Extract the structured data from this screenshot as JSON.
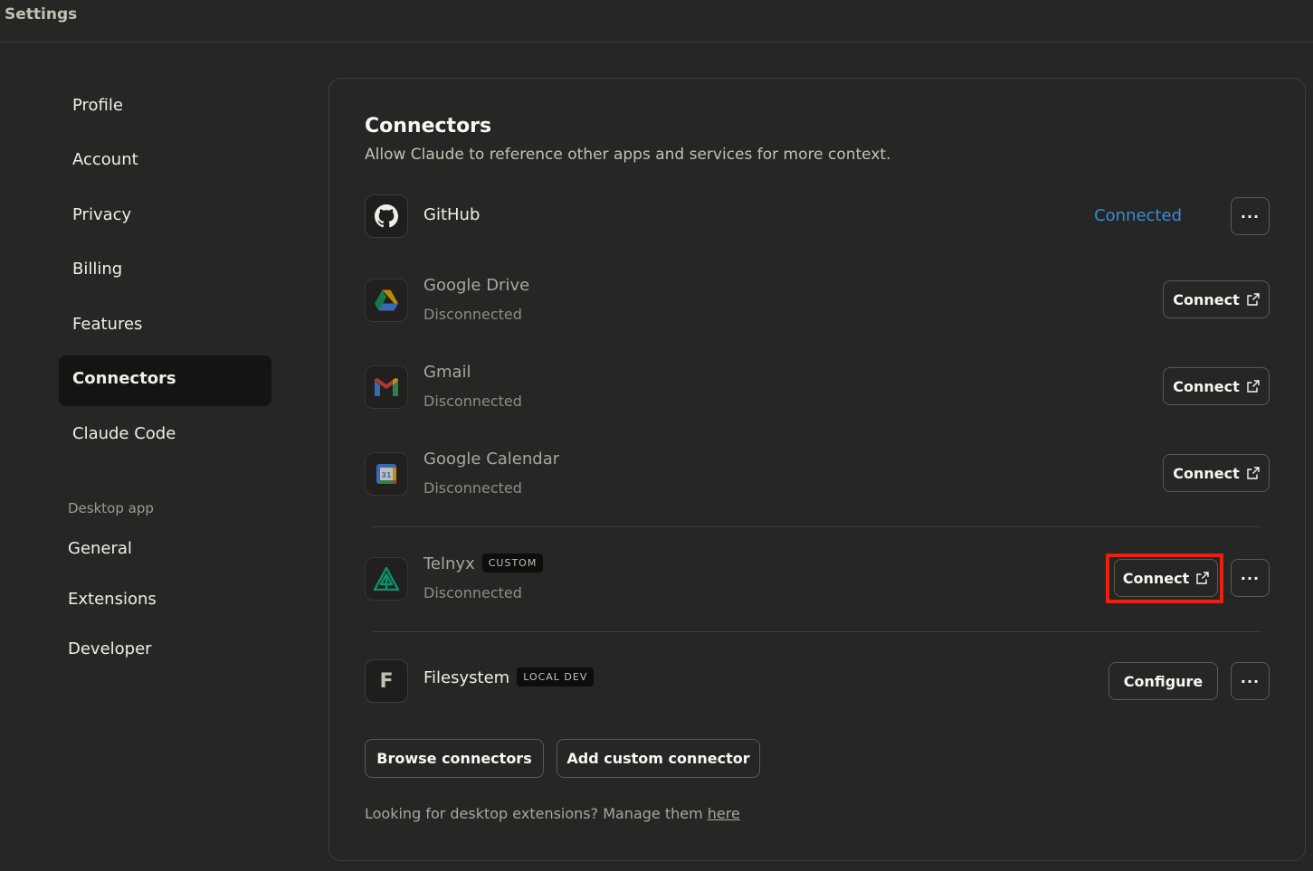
{
  "window": {
    "title": "Settings"
  },
  "sidebar": {
    "items": [
      {
        "label": "Profile"
      },
      {
        "label": "Account"
      },
      {
        "label": "Privacy"
      },
      {
        "label": "Billing"
      },
      {
        "label": "Features"
      },
      {
        "label": "Connectors",
        "active": true
      },
      {
        "label": "Claude Code"
      }
    ],
    "desktop_section_label": "Desktop app",
    "desktop_items": [
      {
        "label": "General"
      },
      {
        "label": "Extensions"
      },
      {
        "label": "Developer"
      }
    ]
  },
  "connectors": {
    "title": "Connectors",
    "subtitle": "Allow Claude to reference other apps and services for more context.",
    "items": [
      {
        "name": "GitHub",
        "icon": "github-icon",
        "status": "Connected",
        "connected": true,
        "more_label": "···"
      },
      {
        "name": "Google Drive",
        "icon": "google-drive-icon",
        "status": "Disconnected",
        "action_label": "Connect"
      },
      {
        "name": "Gmail",
        "icon": "gmail-icon",
        "status": "Disconnected",
        "action_label": "Connect"
      },
      {
        "name": "Google Calendar",
        "icon": "google-calendar-icon",
        "status": "Disconnected",
        "action_label": "Connect",
        "calendar_day": "31"
      },
      {
        "name": "Telnyx",
        "icon": "telnyx-icon",
        "badge": "CUSTOM",
        "status": "Disconnected",
        "action_label": "Connect",
        "more_label": "···",
        "highlighted": true
      },
      {
        "name": "Filesystem",
        "icon": "filesystem-icon",
        "icon_letter": "F",
        "badge": "LOCAL DEV",
        "action_label": "Configure",
        "more_label": "···"
      }
    ],
    "browse_label": "Browse connectors",
    "add_custom_label": "Add custom connector",
    "footer_text": "Looking for desktop extensions? Manage them ",
    "footer_link": "here"
  },
  "colors": {
    "background": "#262624",
    "connected": "#3b8bd7",
    "highlight": "#e8220e",
    "active_nav": "#141413"
  }
}
